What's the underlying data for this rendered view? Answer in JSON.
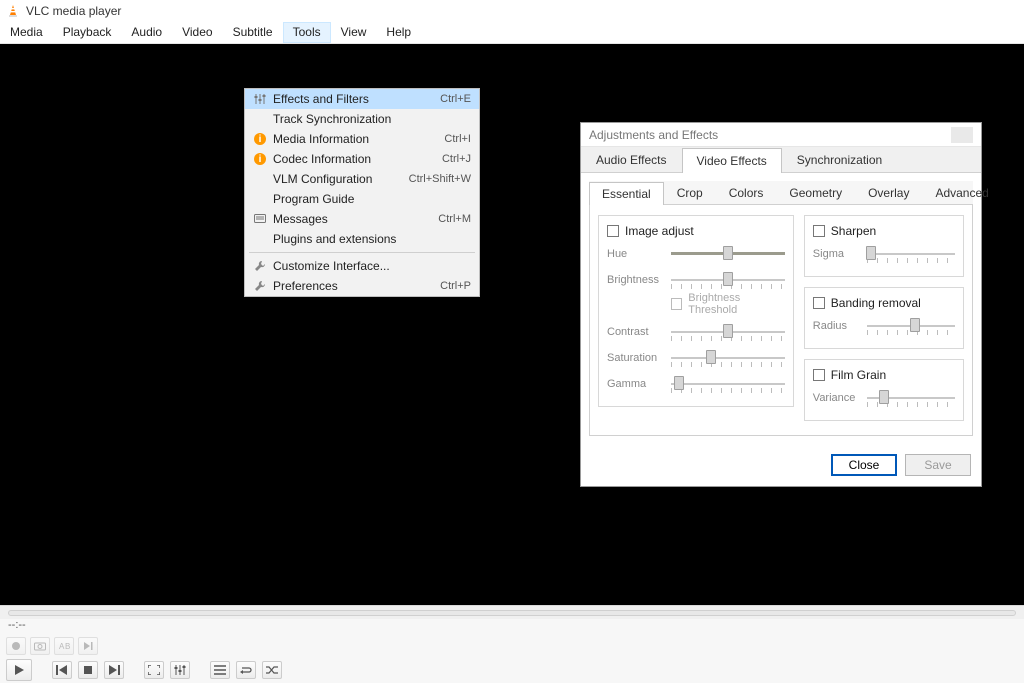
{
  "app": {
    "title": "VLC media player"
  },
  "menubar": [
    "Media",
    "Playback",
    "Audio",
    "Video",
    "Subtitle",
    "Tools",
    "View",
    "Help"
  ],
  "menubar_active": "Tools",
  "tools_menu": {
    "groups": [
      [
        {
          "icon": "sliders",
          "label": "Effects and Filters",
          "shortcut": "Ctrl+E",
          "highlight": true
        },
        {
          "icon": "",
          "label": "Track Synchronization",
          "shortcut": ""
        },
        {
          "icon": "info",
          "label": "Media Information",
          "shortcut": "Ctrl+I"
        },
        {
          "icon": "info",
          "label": "Codec Information",
          "shortcut": "Ctrl+J"
        },
        {
          "icon": "",
          "label": "VLM Configuration",
          "shortcut": "Ctrl+Shift+W"
        },
        {
          "icon": "",
          "label": "Program Guide",
          "shortcut": ""
        },
        {
          "icon": "msg",
          "label": "Messages",
          "shortcut": "Ctrl+M"
        },
        {
          "icon": "",
          "label": "Plugins and extensions",
          "shortcut": ""
        }
      ],
      [
        {
          "icon": "wrench",
          "label": "Customize Interface...",
          "shortcut": ""
        },
        {
          "icon": "wrench",
          "label": "Preferences",
          "shortcut": "Ctrl+P"
        }
      ]
    ]
  },
  "dialog": {
    "title": "Adjustments and Effects",
    "tabs1": [
      "Audio Effects",
      "Video Effects",
      "Synchronization"
    ],
    "tabs1_active": "Video Effects",
    "tabs2": [
      "Essential",
      "Crop",
      "Colors",
      "Geometry",
      "Overlay",
      "Advanced"
    ],
    "tabs2_active": "Essential",
    "image_adjust": {
      "label": "Image adjust",
      "sliders": [
        {
          "name": "Hue",
          "pos": 0.5,
          "filled": true
        },
        {
          "name": "Brightness",
          "pos": 0.5
        },
        {
          "name": "Contrast",
          "pos": 0.5
        },
        {
          "name": "Saturation",
          "pos": 0.35
        },
        {
          "name": "Gamma",
          "pos": 0.07
        }
      ],
      "sub_checkbox": "Brightness Threshold"
    },
    "right_groups": [
      {
        "label": "Sharpen",
        "slider": {
          "name": "Sigma",
          "pos": 0.05
        }
      },
      {
        "label": "Banding removal",
        "slider": {
          "name": "Radius",
          "pos": 0.55
        }
      },
      {
        "label": "Film Grain",
        "slider": {
          "name": "Variance",
          "pos": 0.2
        }
      }
    ],
    "buttons": {
      "close": "Close",
      "save": "Save"
    }
  },
  "status": {
    "time": "--:--"
  }
}
